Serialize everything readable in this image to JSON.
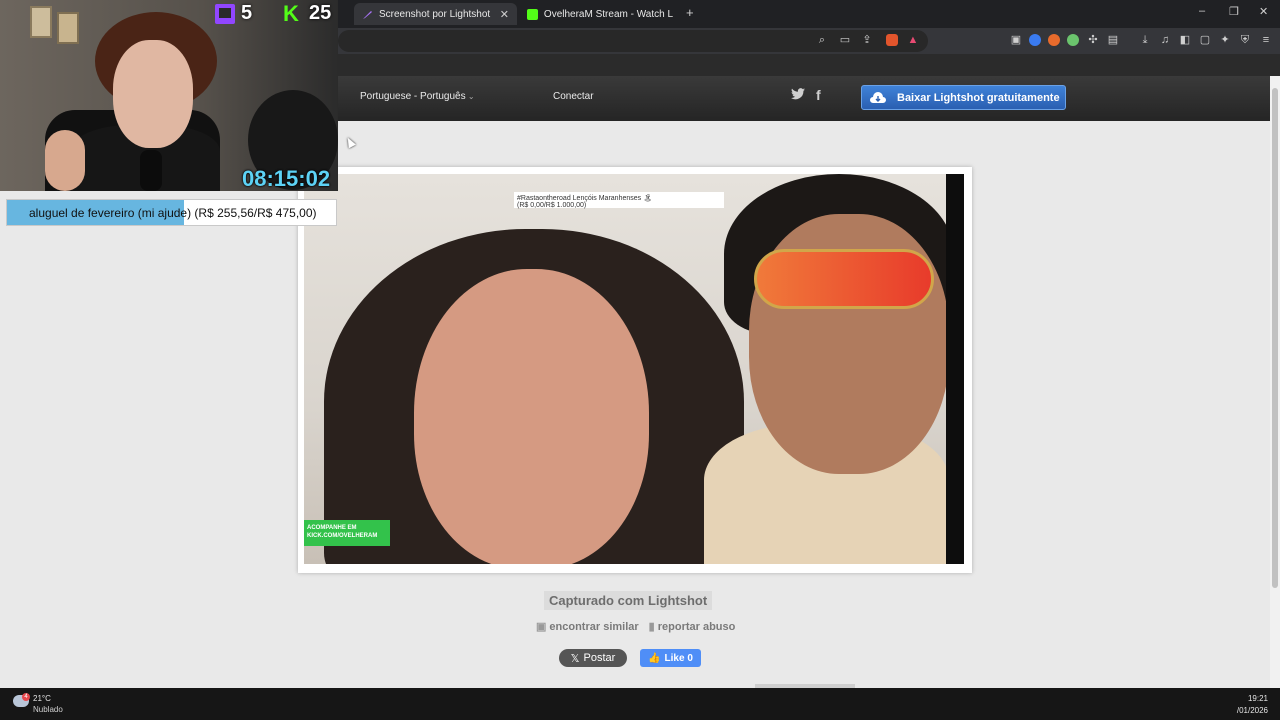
{
  "browser": {
    "tabs": [
      {
        "title": "Screenshot por Lightshot",
        "active": true
      },
      {
        "title": "OvelheraM Stream - Watch Live on K",
        "active": false
      }
    ],
    "new_tab": "+",
    "window_controls": [
      "–",
      "❐",
      "✕"
    ]
  },
  "lightshot": {
    "language": "Portuguese - Português",
    "connect": "Conectar",
    "download_button": "Baixar Lightshot gratuitamente",
    "social": {
      "twitter": "twitter-icon",
      "facebook": "f"
    },
    "captured_label": "Capturado com Lightshot",
    "find_similar": "encontrar similar",
    "report_abuse": "reportar abuso",
    "post_button": "Postar",
    "like_button": "Like 0",
    "screenshot": {
      "goal_title": "#Rastaontheroad Lençóis Maranhenses 🏝",
      "goal_amount": "(R$ 0,00/R$ 1.000,00)",
      "kick_badge_line1": "ACOMPANHE EM",
      "kick_badge_line2": "KICK.COM/OVELHERAM"
    }
  },
  "stream_overlay": {
    "twitch_count": "5",
    "kick_count": "25",
    "timer": "08:15:02",
    "goal_text": "aluguel de fevereiro (mi ajude) (R$ 255,56/R$ 475,00)",
    "goal_progress": 0.538,
    "colors": {
      "twitch": "#9146ff",
      "kick": "#53fc18",
      "timer": "#5dd2f5",
      "goal_fill": "#67b6e0"
    }
  },
  "taskbar": {
    "temperature": "21°C",
    "condition": "Nublado",
    "weather_badge": "4",
    "time": "19:21",
    "date": "/01/2026"
  }
}
